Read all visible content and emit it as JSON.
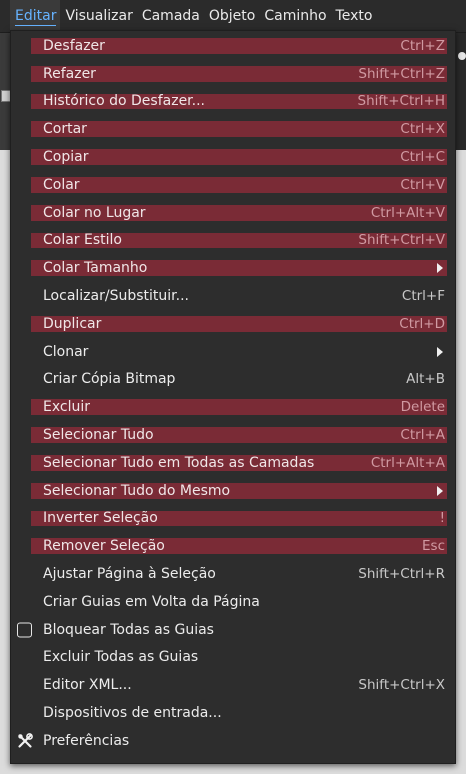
{
  "menubar": {
    "items": [
      "Editar",
      "Visualizar",
      "Camada",
      "Objeto",
      "Caminho",
      "Texto"
    ]
  },
  "menu": {
    "items": [
      {
        "label": "Desfazer",
        "accel": "Ctrl+Z",
        "disabled": true,
        "highlighted": true
      },
      {
        "label": "Refazer",
        "accel": "Shift+Ctrl+Z",
        "disabled": true,
        "highlighted": true
      },
      {
        "label": "Histórico do Desfazer...",
        "accel": "Shift+Ctrl+H",
        "highlighted": true
      },
      {
        "label": "Cortar",
        "accel": "Ctrl+X",
        "highlighted": true
      },
      {
        "label": "Copiar",
        "accel": "Ctrl+C",
        "highlighted": true
      },
      {
        "label": "Colar",
        "accel": "Ctrl+V",
        "highlighted": true
      },
      {
        "label": "Colar no Lugar",
        "accel": "Ctrl+Alt+V",
        "highlighted": true
      },
      {
        "label": "Colar Estilo",
        "accel": "Shift+Ctrl+V",
        "highlighted": true
      },
      {
        "label": "Colar Tamanho",
        "accel": "",
        "submenu": true,
        "highlighted": true
      },
      {
        "label": "Localizar/Substituir...",
        "accel": "Ctrl+F"
      },
      {
        "label": "Duplicar",
        "accel": "Ctrl+D",
        "highlighted": true
      },
      {
        "label": "Clonar",
        "accel": "",
        "submenu": true
      },
      {
        "label": "Criar Cópia Bitmap",
        "accel": "Alt+B"
      },
      {
        "label": "Excluir",
        "accel": "Delete",
        "highlighted": true
      },
      {
        "label": "Selecionar Tudo",
        "accel": "Ctrl+A",
        "highlighted": true
      },
      {
        "label": "Selecionar Tudo em Todas as Camadas",
        "accel": "Ctrl+Alt+A",
        "highlighted": true
      },
      {
        "label": "Selecionar Tudo do Mesmo",
        "accel": "",
        "submenu": true,
        "highlighted": true
      },
      {
        "label": "Inverter Seleção",
        "accel": "!",
        "highlighted": true
      },
      {
        "label": "Remover Seleção",
        "accel": "Esc",
        "highlighted": true
      },
      {
        "label": "Ajustar Página à Seleção",
        "accel": "Shift+Ctrl+R"
      },
      {
        "label": "Criar Guias em Volta da Página",
        "accel": ""
      },
      {
        "label": "Bloquear Todas as Guias",
        "accel": "",
        "icon": "checkbox-icon"
      },
      {
        "label": "Excluir Todas as Guias",
        "accel": ""
      },
      {
        "label": "Editor XML...",
        "accel": "Shift+Ctrl+X"
      },
      {
        "label": "Dispositivos de entrada...",
        "accel": ""
      },
      {
        "label": "Preferências",
        "accel": "",
        "icon": "preferences-tools-icon"
      }
    ]
  },
  "colors": {
    "highlight": "#7a2b36",
    "accent": "#66b3ff",
    "menu_bg": "#2d2d2d"
  }
}
